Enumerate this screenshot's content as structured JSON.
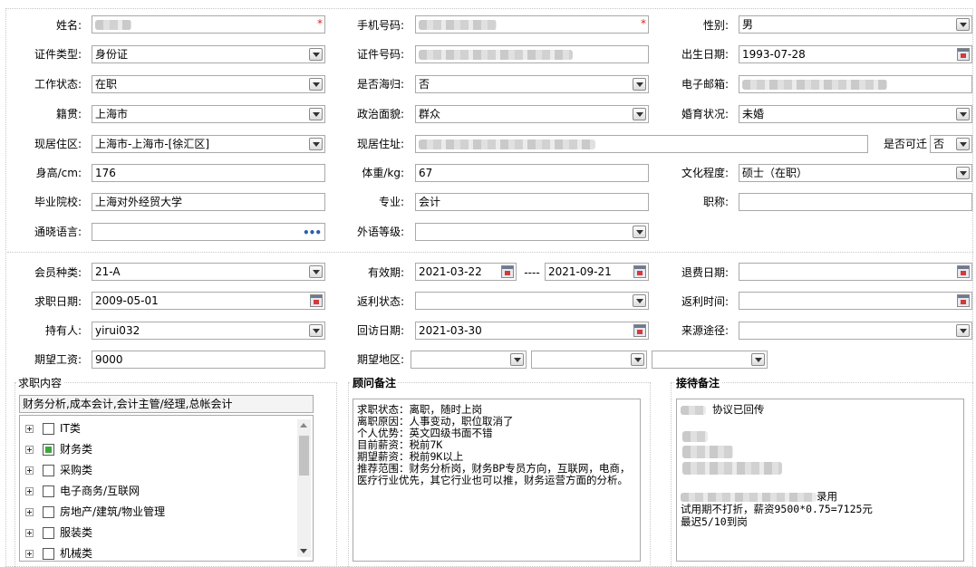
{
  "personal": {
    "name_label": "姓名:",
    "phone_label": "手机号码:",
    "gender_label": "性别:",
    "gender": "男",
    "id_type_label": "证件类型:",
    "id_type": "身份证",
    "id_number_label": "证件号码:",
    "birth_label": "出生日期:",
    "birth": "1993-07-28",
    "work_status_label": "工作状态:",
    "work_status": "在职",
    "returnee_label": "是否海归:",
    "returnee": "否",
    "email_label": "电子邮箱:",
    "native_label": "籍贯:",
    "native": "上海市",
    "political_label": "政治面貌:",
    "political": "群众",
    "marital_label": "婚育状况:",
    "marital": "未婚",
    "residence_area_label": "现居住区:",
    "residence_area": "上海市-上海市-[徐汇区]",
    "residence_addr_label": "现居住址:",
    "relocate_label": "是否可迁",
    "relocate": "否",
    "height_label": "身高/cm:",
    "height": "176",
    "weight_label": "体重/kg:",
    "weight": "67",
    "education_label": "文化程度:",
    "education": "硕士（在职）",
    "school_label": "毕业院校:",
    "school": "上海对外经贸大学",
    "major_label": "专业:",
    "major": "会计",
    "title_label": "职称:",
    "language_label": "通晓语言:",
    "lang_level_label": "外语等级:"
  },
  "membership": {
    "type_label": "会员种类:",
    "type": "21-A",
    "validity_label": "有效期:",
    "valid_from": "2021-03-22",
    "range_sep": "----",
    "valid_to": "2021-09-21",
    "refund_label": "退费日期:",
    "job_date_label": "求职日期:",
    "job_date": "2009-05-01",
    "rebate_status_label": "返利状态:",
    "rebate_time_label": "返利时间:",
    "holder_label": "持有人:",
    "holder": "yirui032",
    "revisit_label": "回访日期:",
    "revisit": "2021-03-30",
    "source_label": "来源途径:",
    "salary_label": "期望工资:",
    "salary": "9000",
    "region_label": "期望地区:"
  },
  "job_content": {
    "title": "求职内容",
    "summary": "财务分析,成本会计,会计主管/经理,总帐会计",
    "items": [
      {
        "label": "IT类",
        "checked": false
      },
      {
        "label": "财务类",
        "checked": true
      },
      {
        "label": "采购类",
        "checked": false
      },
      {
        "label": "电子商务/互联网",
        "checked": false
      },
      {
        "label": "房地产/建筑/物业管理",
        "checked": false
      },
      {
        "label": "服装类",
        "checked": false
      },
      {
        "label": "机械类",
        "checked": false
      }
    ]
  },
  "consultant_notes": {
    "title": "顾问备注",
    "text": "求职状态：离职，随时上岗\n离职原因：人事变动，职位取消了\n个人优势：英文四级书面不错\n目前薪资：税前7K\n期望薪资：税前9K以上\n推荐范围：财务分析岗，财务BP专员方向，互联网，电商，医疗行业优先，其它行业也可以推，财务运营方面的分析。"
  },
  "reception_notes": {
    "title": "接待备注",
    "line1": "协议已回传",
    "line2": "录用",
    "line3": "试用期不打折，薪资9500*0.75=7125元",
    "line4": "最迟5/10到岗"
  },
  "colors": {
    "required": "#e02020",
    "checked": "#3aa83a",
    "border": "#a9a9a9"
  }
}
